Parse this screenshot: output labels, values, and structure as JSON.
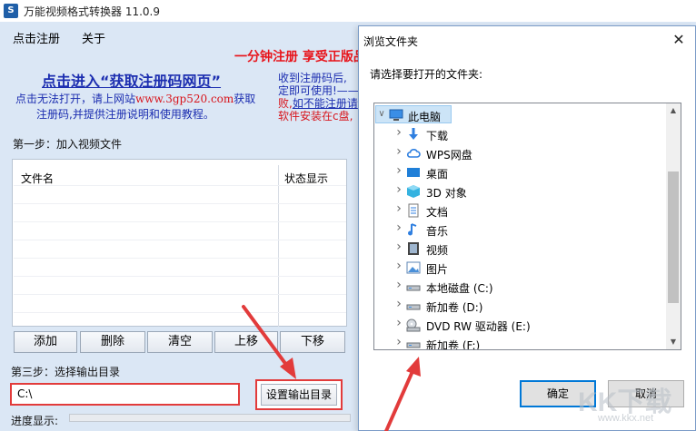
{
  "app": {
    "title": "万能视频格式转换器 11.0.9",
    "icon_char": "S"
  },
  "menu": {
    "register": "点击注册",
    "about": "关于"
  },
  "promo": {
    "banner": "一分钟注册  享受正版品",
    "reg_link": "点击进入“获取注册码网页”",
    "help_line1_prefix": "点击无法打开，请上网站",
    "help_url": "www.3gp520.com",
    "help_line1_suffix": "获取",
    "help_line2": "注册码,并提供注册说明和使用教程。",
    "right_line1": "收到注册码后,",
    "right_line2": "定即可使用!——",
    "right_line3_a": "败,",
    "right_line3_b": "如不能注册请",
    "right_line4": "软件安装在c盘,"
  },
  "step1": {
    "label": "第一步：加入视频文件"
  },
  "file_list": {
    "col_filename": "文件名",
    "col_status": "状态显示"
  },
  "toolbar": {
    "add": "添加",
    "delete": "删除",
    "clear": "清空",
    "move_up": "上移",
    "move_down": "下移"
  },
  "step3": {
    "label": "第三步：选择输出目录",
    "output_path": "C:\\",
    "set_output_button": "设置输出目录"
  },
  "progress": {
    "label": "进度显示:"
  },
  "dialog": {
    "title": "浏览文件夹",
    "close_glyph": "✕",
    "prompt": "请选择要打开的文件夹:",
    "ok": "确定",
    "cancel": "取消",
    "tree": {
      "root": {
        "label": "此电脑",
        "icon": "computer-icon"
      },
      "items": [
        {
          "label": "下载",
          "icon": "download-icon"
        },
        {
          "label": "WPS网盘",
          "icon": "cloud-icon"
        },
        {
          "label": "桌面",
          "icon": "desktop-icon"
        },
        {
          "label": "3D 对象",
          "icon": "cube-icon"
        },
        {
          "label": "文档",
          "icon": "document-icon"
        },
        {
          "label": "音乐",
          "icon": "music-icon"
        },
        {
          "label": "视频",
          "icon": "video-icon"
        },
        {
          "label": "图片",
          "icon": "picture-icon"
        },
        {
          "label": "本地磁盘 (C:)",
          "icon": "drive-icon"
        },
        {
          "label": "新加卷 (D:)",
          "icon": "drive-icon"
        },
        {
          "label": "DVD RW 驱动器 (E:)",
          "icon": "dvd-icon"
        },
        {
          "label": "新加卷 (F:)",
          "icon": "drive-icon"
        }
      ]
    }
  },
  "watermark": {
    "text": "KK下载",
    "sub": "www.kkx.net"
  },
  "colors": {
    "annotation_red": "#e23b3b",
    "link_blue": "#1c2eb0",
    "promo_red": "#e8141b",
    "selection_blue": "#cce4f7"
  }
}
